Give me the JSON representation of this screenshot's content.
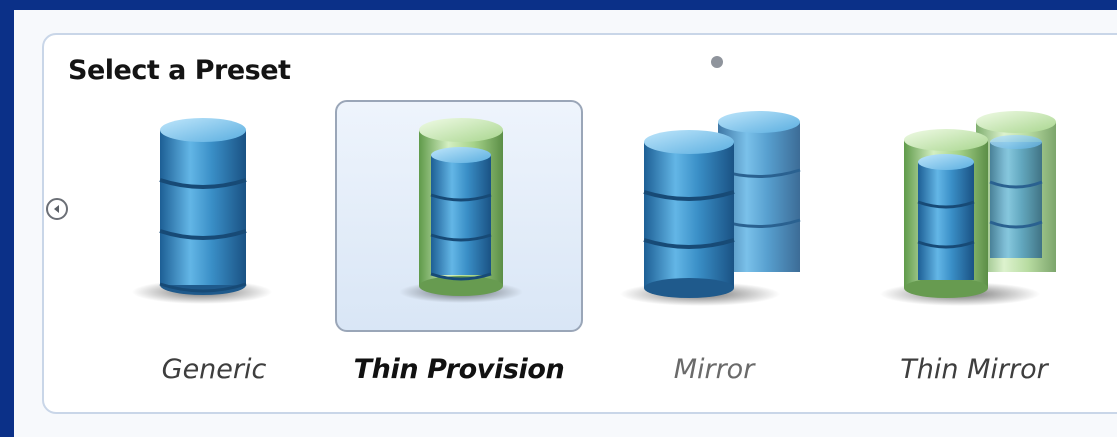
{
  "panel": {
    "title": "Select a Preset",
    "presets": [
      {
        "label": "Generic",
        "selected": false,
        "icon": "database-icon"
      },
      {
        "label": "Thin Provision",
        "selected": true,
        "icon": "thin-database-icon"
      },
      {
        "label": "Mirror",
        "selected": false,
        "icon": "mirror-database-icon"
      },
      {
        "label": "Thin Mirror",
        "selected": false,
        "icon": "thin-mirror-database-icon"
      }
    ]
  },
  "colors": {
    "background": "#0b3088",
    "selected_fill": "#dde8f7",
    "selected_border": "#9aa6b8",
    "cylinder_blue": "#3d8fc4",
    "cylinder_green": "#a6d38a"
  }
}
